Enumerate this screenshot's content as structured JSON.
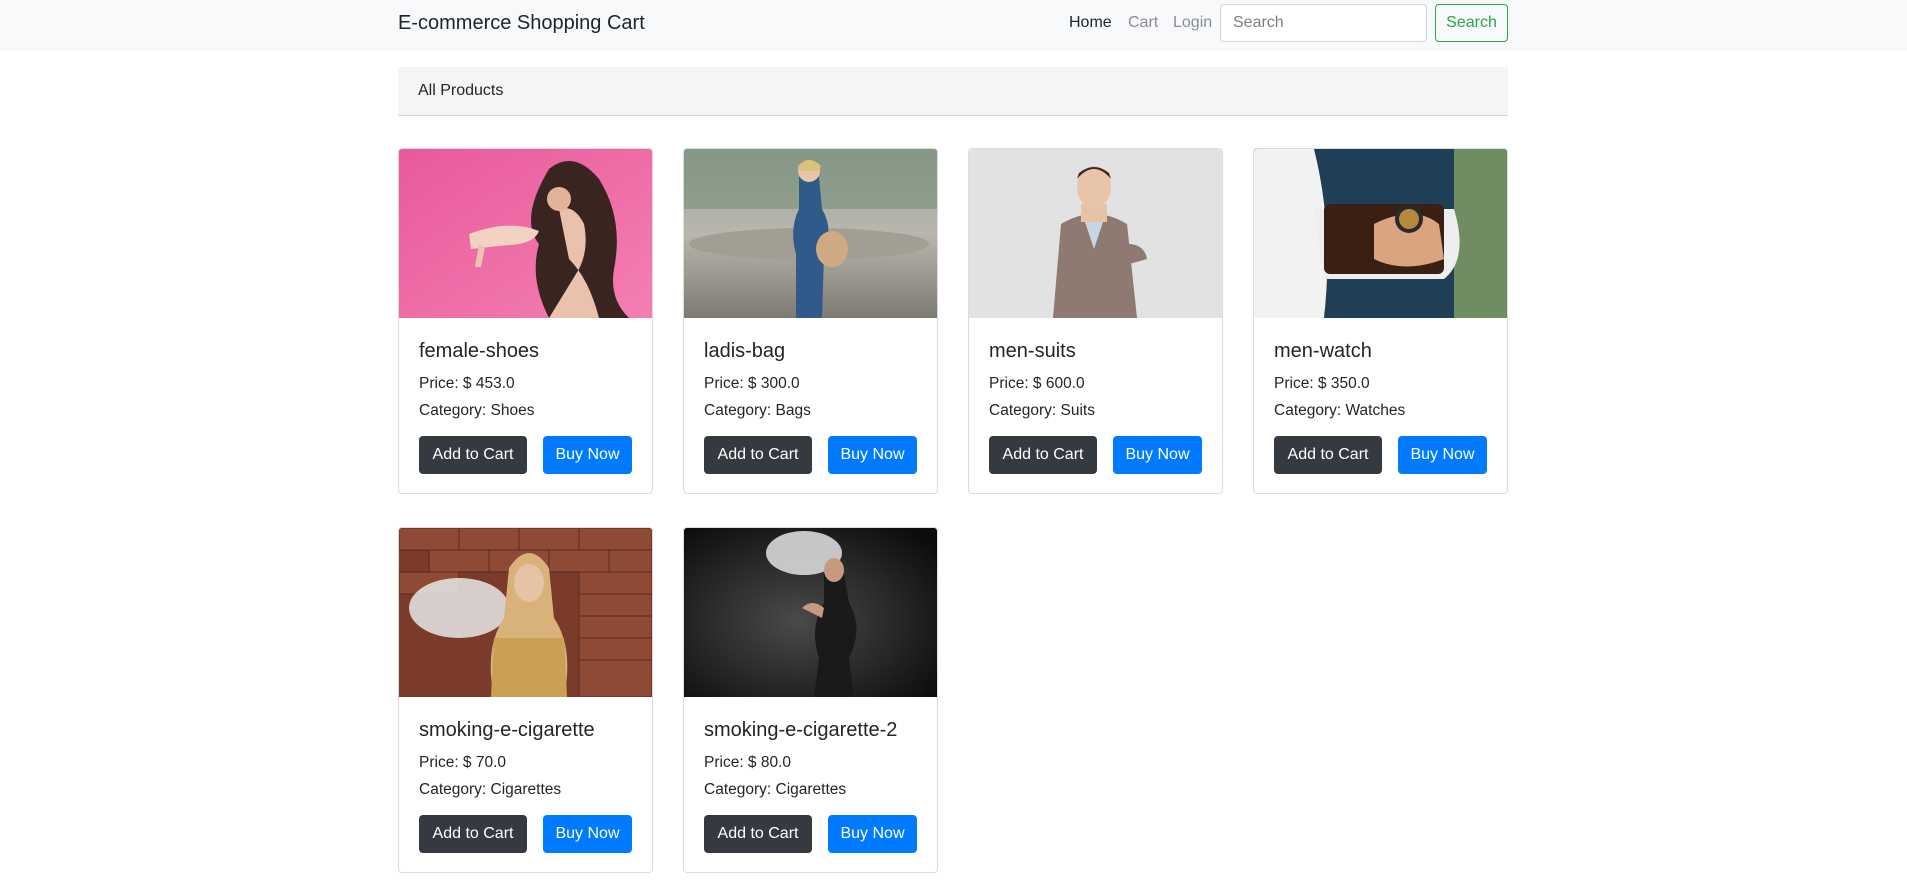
{
  "navbar": {
    "brand": "E-commerce Shopping Cart",
    "links": [
      "Home",
      "Cart",
      "Login"
    ],
    "search_placeholder": "Search",
    "search_button": "Search"
  },
  "breadcrumb": "All Products",
  "colors": {
    "accent_green": "#28a745",
    "primary_blue": "#007bff",
    "dark_button": "#343a40",
    "navbar_bg": "#f8f9fa"
  },
  "buttons": {
    "add_to_cart": "Add to Cart",
    "buy_now": "Buy Now"
  },
  "products": [
    {
      "name": "female-shoes",
      "price": "Price: $ 453.0",
      "category": "Category: Shoes",
      "image": "woman-holding-shoe-photo"
    },
    {
      "name": "ladis-bag",
      "price": "Price: $ 300.0",
      "category": "Category: Bags",
      "image": "woman-with-bag-photo"
    },
    {
      "name": "men-suits",
      "price": "Price: $ 600.0",
      "category": "Category: Suits",
      "image": "man-in-suit-photo"
    },
    {
      "name": "men-watch",
      "price": "Price: $ 350.0",
      "category": "Category: Watches",
      "image": "man-wearing-watch-photo"
    },
    {
      "name": "smoking-e-cigarette",
      "price": "Price: $ 70.0",
      "category": "Category: Cigarettes",
      "image": "woman-vaping-brick-wall-photo"
    },
    {
      "name": "smoking-e-cigarette-2",
      "price": "Price: $ 80.0",
      "category": "Category: Cigarettes",
      "image": "woman-vaping-dark-photo"
    }
  ]
}
